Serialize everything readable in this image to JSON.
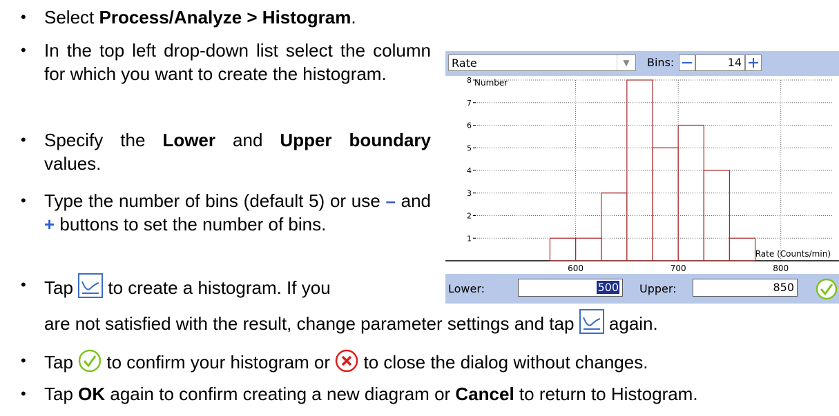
{
  "instructions": {
    "b1": {
      "pre": "Select ",
      "bold": "Process/Analyze > Histogram",
      "post": "."
    },
    "b2": {
      "text": "In the top left drop-down list select the column for which you want to create the histogram."
    },
    "b3": {
      "pre": "Specify the ",
      "bold1": "Lower",
      "mid": " and ",
      "bold2": "Upper boundary",
      "post": " values."
    },
    "b4": {
      "pre": "Type the number of bins (default 5) or use ",
      "minus": "–",
      "and": " and ",
      "plus": "+",
      "post": " buttons to set the number of bins."
    },
    "b5": {
      "pre": "Tap ",
      "post": " to create a histogram. If you",
      "cont_pre": "are not satisfied with the result, change parameter settings and tap ",
      "cont_post": " again."
    },
    "b6": {
      "pre": "Tap ",
      "mid": " to confirm your histogram or ",
      "post": " to close the dialog without changes."
    },
    "b7": {
      "pre": "Tap ",
      "ok": "OK",
      "mid": " again to confirm creating a new diagram or ",
      "cancel": "Cancel",
      "post": " to return to Histogram."
    }
  },
  "dialog": {
    "column_select": "Rate",
    "bins_label": "Bins:",
    "bins_value": "14",
    "lower_label": "Lower:",
    "lower_value": "500",
    "upper_label": "Upper:",
    "upper_value": "850"
  },
  "chart_data": {
    "type": "bar",
    "ylabel": "Number",
    "xlabel": "Rate (Counts/min)",
    "xlim": [
      500,
      850
    ],
    "ylim": [
      0,
      8
    ],
    "xticks": [
      600,
      700,
      800
    ],
    "yticks": [
      1,
      2,
      3,
      4,
      5,
      6,
      7,
      8
    ],
    "grid": true,
    "bins": [
      {
        "start": 575,
        "end": 600,
        "value": 1
      },
      {
        "start": 600,
        "end": 625,
        "value": 1
      },
      {
        "start": 625,
        "end": 650,
        "value": 3
      },
      {
        "start": 650,
        "end": 675,
        "value": 8
      },
      {
        "start": 675,
        "end": 700,
        "value": 5
      },
      {
        "start": 700,
        "end": 725,
        "value": 6
      },
      {
        "start": 725,
        "end": 750,
        "value": 4
      },
      {
        "start": 750,
        "end": 775,
        "value": 1
      }
    ],
    "bar_color": "#a52a2a"
  },
  "icons": {
    "histogram": "histogram-icon",
    "confirm": "check-circle-icon",
    "close": "close-circle-icon"
  }
}
